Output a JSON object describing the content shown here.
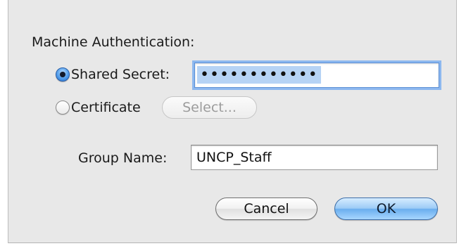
{
  "dialog": {
    "section_label": "Machine Authentication:",
    "shared_secret": {
      "label": "Shared Secret:",
      "selected": true,
      "value": "••••••••••••"
    },
    "certificate": {
      "label": "Certificate",
      "selected": false,
      "select_button_label": "Select...",
      "select_button_enabled": false
    },
    "group_name": {
      "label": "Group Name:",
      "value": "UNCP_Staff"
    },
    "buttons": {
      "cancel_label": "Cancel",
      "ok_label": "OK"
    }
  },
  "colors": {
    "sheet_background": "#e8e8e8",
    "focus_ring": "#8db8ef",
    "default_button": "#6aaeee",
    "selection_highlight": "#b6d3f5"
  }
}
